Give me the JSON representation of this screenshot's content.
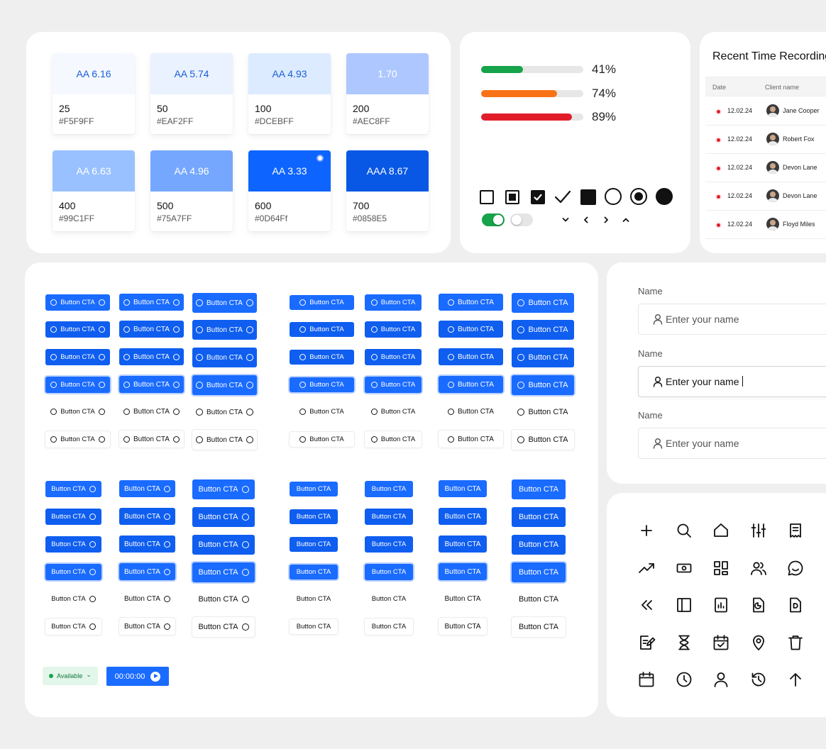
{
  "palette": {
    "swatches": [
      {
        "contrast": "AA 6.16",
        "name": "25",
        "hex": "#F5F9FF",
        "bg": "#F5F9FF",
        "fg": "#1a5fd6"
      },
      {
        "contrast": "AA 5.74",
        "name": "50",
        "hex": "#EAF2FF",
        "bg": "#EAF2FF",
        "fg": "#1a5fd6"
      },
      {
        "contrast": "AA 4.93",
        "name": "100",
        "hex": "#DCEBFF",
        "bg": "#DCEBFF",
        "fg": "#1a5fd6"
      },
      {
        "contrast": "1.70",
        "name": "200",
        "hex": "#AEC8FF",
        "bg": "#AEC8FF",
        "fg": "#ffffff"
      },
      {
        "contrast": "AA 6.63",
        "name": "400",
        "hex": "#99C1FF",
        "bg": "#99C1FF",
        "fg": "#ffffff"
      },
      {
        "contrast": "AA 4.96",
        "name": "500",
        "hex": "#75A7FF",
        "bg": "#75A7FF",
        "fg": "#ffffff"
      },
      {
        "contrast": "AA 3.33",
        "name": "600",
        "hex": "#0D64Ff",
        "bg": "#0D64FF",
        "fg": "#ffffff"
      },
      {
        "contrast": "AAA 8.67",
        "name": "700",
        "hex": "#0858E5",
        "bg": "#0858E5",
        "fg": "#ffffff"
      }
    ]
  },
  "progress": {
    "bars": [
      {
        "label": "41%",
        "value": 0.41,
        "color": "#16a34a"
      },
      {
        "label": "74%",
        "value": 0.74,
        "color": "#f97316"
      },
      {
        "label": "89%",
        "value": 0.89,
        "color": "#e11d2a"
      }
    ],
    "toggle_on_color": "#16a34a"
  },
  "table": {
    "title": "Recent Time Recording",
    "col_date": "Date",
    "col_client": "Client name",
    "rows": [
      {
        "date": "12.02.24",
        "client": "Jane Cooper"
      },
      {
        "date": "12.02.24",
        "client": "Robert Fox"
      },
      {
        "date": "12.02.24",
        "client": "Devon Lane"
      },
      {
        "date": "12.02.24",
        "client": "Devon Lane"
      },
      {
        "date": "12.02.24",
        "client": "Floyd Miles"
      }
    ]
  },
  "buttons": {
    "label": "Button CTA",
    "primary_color": "#1a6bff"
  },
  "status": {
    "badge_label": "Available",
    "badge_caret": "⌄",
    "timer_label": "00:00:00"
  },
  "form": {
    "fields": [
      {
        "label": "Name",
        "placeholder": "Enter your name",
        "state": "default"
      },
      {
        "label": "Name",
        "value": "Enter your name",
        "state": "active"
      },
      {
        "label": "Name",
        "placeholder": "Enter your name",
        "state": "default"
      }
    ]
  },
  "icons": {
    "names": [
      "plus-icon",
      "search-icon",
      "home-icon",
      "sliders-icon",
      "receipt-icon",
      "trending-up-icon",
      "banknote-icon",
      "dashboard-icon",
      "users-icon",
      "chat-icon",
      "chevrons-left-icon",
      "sidebar-icon",
      "report-icon",
      "file-chart-icon",
      "file-d-icon",
      "edit-note-icon",
      "hourglass-icon",
      "calendar-check-icon",
      "map-pin-icon",
      "trash-icon",
      "calendar-icon",
      "clock-icon",
      "user-icon",
      "history-icon",
      "arrow-up-icon"
    ]
  }
}
